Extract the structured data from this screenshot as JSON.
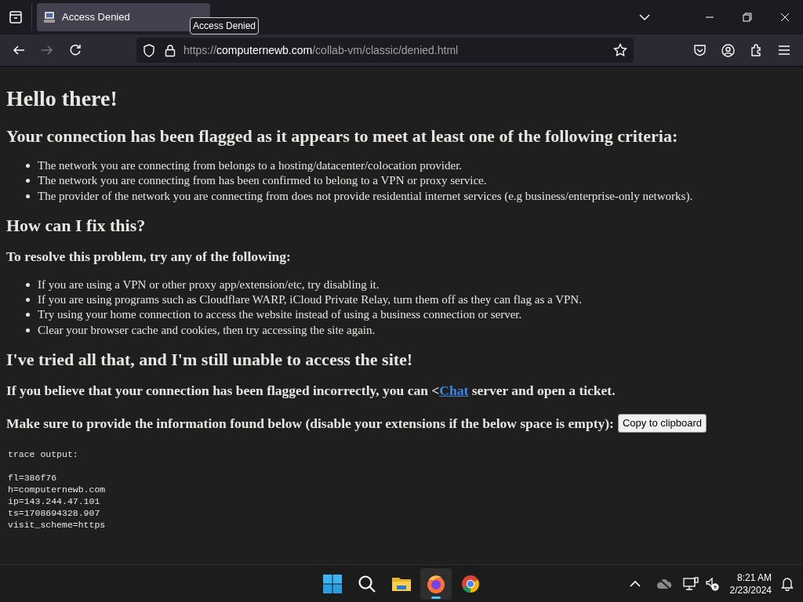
{
  "browser": {
    "tabs": [
      {
        "title": "Access Denied",
        "selected": true
      }
    ],
    "tooltip": "Access Denied",
    "url": {
      "scheme": "https://",
      "domain": "computernewb.com",
      "path": "/collab-vm/classic/denied.html"
    }
  },
  "page": {
    "heading": "Hello there!",
    "sections": [
      {
        "kind": "h2",
        "text": "Your connection has been flagged as it appears to meet at least one of the following criteria:"
      },
      {
        "kind": "list",
        "items": [
          "The network you are connecting from belongs to a hosting/datacenter/colocation provider.",
          "The network you are connecting from has been confirmed to belong to a VPN or proxy service.",
          "The provider of the network you are connecting from does not provide residential internet services (e.g business/enterprise-only networks)."
        ]
      },
      {
        "kind": "h2",
        "text": "How can I fix this?"
      },
      {
        "kind": "h3",
        "text": "To resolve this problem, try any of the following:"
      },
      {
        "kind": "list",
        "items": [
          "If you are using a VPN or other proxy app/extension/etc, try disabling it.",
          "If you are using programs such as Cloudflare WARP, iCloud Private Relay, turn them off as they can flag as a VPN.",
          "Try using your home connection to access the website instead of using a business connection or server.",
          "Clear your browser cache and cookies, then try accessing the site again."
        ]
      },
      {
        "kind": "h2",
        "text": "I've tried all that, and I'm still unable to access the site!"
      },
      {
        "kind": "link_line",
        "before": "If you believe that your connection has been flagged incorrectly, you can <",
        "link": "Chat",
        "after": " server and open a ticket."
      },
      {
        "kind": "button_line",
        "text": "Make sure to provide the information found below (disable your extensions if the below space is empty):",
        "button": "Copy to clipboard"
      },
      {
        "kind": "pre",
        "header": "trace output:",
        "lines": [
          "fl=386f76",
          "h=computernewb.com",
          "ip=143.244.47.101",
          "ts=1708694328.907",
          "visit_scheme=https"
        ]
      }
    ]
  },
  "taskbar": {
    "apps": [
      {
        "kind": "start",
        "selected": false
      },
      {
        "kind": "search",
        "selected": false
      },
      {
        "kind": "folder",
        "selected": false
      },
      {
        "kind": "firefox",
        "selected": true
      },
      {
        "kind": "chrome",
        "selected": false
      }
    ],
    "time": "8:21 AM",
    "date": "2/23/2024"
  }
}
